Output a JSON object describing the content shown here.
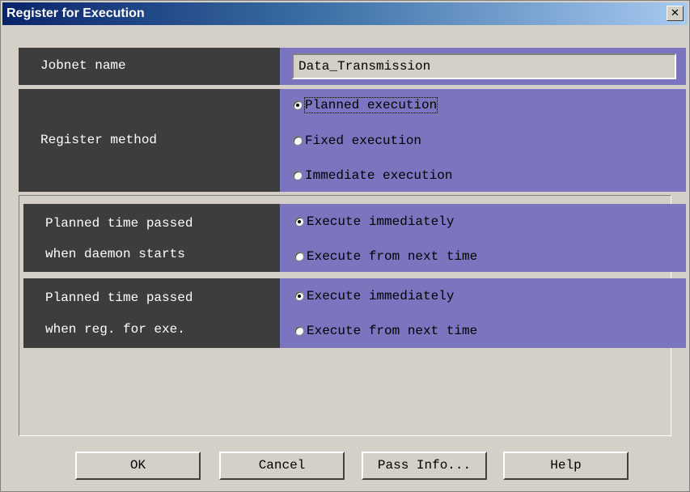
{
  "window": {
    "title": "Register for Execution",
    "close_glyph": "✕"
  },
  "jobnet": {
    "label": "Jobnet name",
    "value": "Data_Transmission"
  },
  "register_method": {
    "label": "Register method",
    "options": [
      {
        "label": "Planned execution",
        "selected": true
      },
      {
        "label": "Fixed execution",
        "selected": false
      },
      {
        "label": "Immediate execution",
        "selected": false
      }
    ]
  },
  "daemon_start": {
    "label_line1": "Planned time passed",
    "label_line2": "when daemon starts",
    "options": [
      {
        "label": "Execute immediately",
        "selected": true
      },
      {
        "label": "Execute from next time",
        "selected": false
      }
    ]
  },
  "reg_for_exe": {
    "label_line1": "Planned time passed",
    "label_line2": "when reg. for exe.",
    "options": [
      {
        "label": "Execute immediately",
        "selected": true
      },
      {
        "label": "Execute from next time",
        "selected": false
      }
    ]
  },
  "buttons": {
    "ok": "OK",
    "cancel": "Cancel",
    "pass_info": "Pass Info...",
    "help": "Help"
  },
  "colors": {
    "label_bg": "#3d3d3d",
    "value_bg": "#7b74be",
    "dialog_bg": "#d4d0c8"
  }
}
